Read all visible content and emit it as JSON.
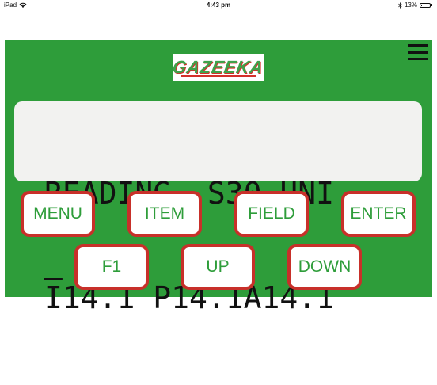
{
  "status_bar": {
    "device": "iPad",
    "wifi_icon": "wifi-icon",
    "time": "4:43 pm",
    "bluetooth_icon": "bluetooth-icon",
    "battery_percent_label": "13%",
    "battery_level": 0.13
  },
  "brand": {
    "logo_text": "GAZEEKA"
  },
  "display": {
    "line1_cursor_char": "R",
    "line1_rest": "EADING  S30 UNI",
    "line2_cursor_char": "I",
    "line2_rest": "14.1 P14.1A14.1"
  },
  "buttons": {
    "menu": "MENU",
    "item": "ITEM",
    "field": "FIELD",
    "enter": "ENTER",
    "f1": "F1",
    "up": "UP",
    "down": "DOWN"
  },
  "colors": {
    "panel_green": "#2e9d3a",
    "button_border_red": "#c8302a",
    "lcd_background": "#f2f2f0"
  }
}
